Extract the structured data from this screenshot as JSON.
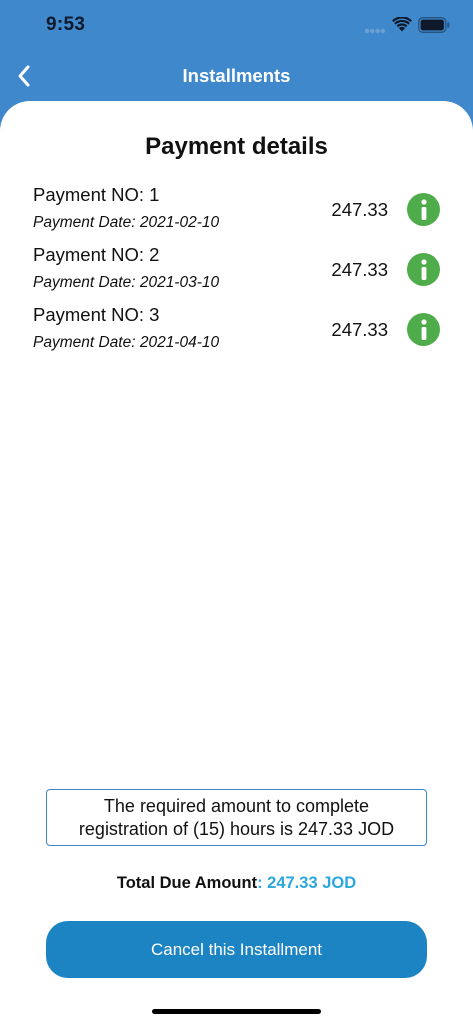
{
  "status_bar": {
    "time": "9:53"
  },
  "nav": {
    "title": "Installments",
    "back_icon": "chevron-left-icon"
  },
  "content": {
    "title": "Payment details",
    "payments": [
      {
        "number_label": "Payment NO: 1",
        "date_label": "Payment Date: 2021-02-10",
        "amount": "247.33",
        "icon": "info-icon"
      },
      {
        "number_label": "Payment NO: 2",
        "date_label": "Payment Date: 2021-03-10",
        "amount": "247.33",
        "icon": "info-icon"
      },
      {
        "number_label": "Payment NO: 3",
        "date_label": "Payment Date: 2021-04-10",
        "amount": "247.33",
        "icon": "info-icon"
      }
    ],
    "notice": "The required amount to complete registration of (15) hours is 247.33 JOD",
    "total_label": "Total Due Amount",
    "total_value": ": 247.33 JOD",
    "cancel_button_label": "Cancel this Installment"
  },
  "colors": {
    "header_blue": "#3f88cc",
    "button_blue": "#1d84c4",
    "info_green": "#4fac4a",
    "total_value": "#2aa7dd"
  }
}
